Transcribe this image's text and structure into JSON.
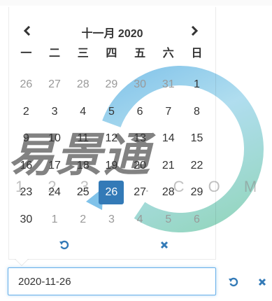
{
  "background": {
    "text_left": "...",
    "text_right": "..."
  },
  "calendar": {
    "month_title": "十一月 2020",
    "weekdays": [
      "一",
      "二",
      "三",
      "四",
      "五",
      "六",
      "日"
    ],
    "weeks": [
      [
        {
          "d": "26",
          "m": true
        },
        {
          "d": "27",
          "m": true
        },
        {
          "d": "28",
          "m": true
        },
        {
          "d": "29",
          "m": true
        },
        {
          "d": "30",
          "m": true
        },
        {
          "d": "31",
          "m": true
        },
        {
          "d": "1",
          "m": false
        }
      ],
      [
        {
          "d": "2",
          "m": false
        },
        {
          "d": "3",
          "m": false
        },
        {
          "d": "4",
          "m": false
        },
        {
          "d": "5",
          "m": false
        },
        {
          "d": "6",
          "m": false
        },
        {
          "d": "7",
          "m": false
        },
        {
          "d": "8",
          "m": false
        }
      ],
      [
        {
          "d": "9",
          "m": false
        },
        {
          "d": "10",
          "m": false
        },
        {
          "d": "11",
          "m": false
        },
        {
          "d": "12",
          "m": false
        },
        {
          "d": "13",
          "m": false
        },
        {
          "d": "14",
          "m": false
        },
        {
          "d": "15",
          "m": false
        }
      ],
      [
        {
          "d": "16",
          "m": false
        },
        {
          "d": "17",
          "m": false
        },
        {
          "d": "18",
          "m": false
        },
        {
          "d": "19",
          "m": false
        },
        {
          "d": "20",
          "m": false
        },
        {
          "d": "21",
          "m": false
        },
        {
          "d": "22",
          "m": false
        }
      ],
      [
        {
          "d": "23",
          "m": false
        },
        {
          "d": "24",
          "m": false
        },
        {
          "d": "25",
          "m": false
        },
        {
          "d": "26",
          "m": false,
          "selected": true
        },
        {
          "d": "27",
          "m": false
        },
        {
          "d": "28",
          "m": false
        },
        {
          "d": "29",
          "m": false
        }
      ],
      [
        {
          "d": "30",
          "m": false
        },
        {
          "d": "1",
          "m": true
        },
        {
          "d": "2",
          "m": true
        },
        {
          "d": "3",
          "m": true
        },
        {
          "d": "4",
          "m": true
        },
        {
          "d": "5",
          "m": true
        },
        {
          "d": "6",
          "m": true
        }
      ]
    ],
    "icons": {
      "prev": "chevron-left-icon",
      "next": "chevron-right-icon",
      "reset": "undo-icon",
      "clear": "close-icon"
    },
    "selected_color": "#337ab7"
  },
  "input": {
    "value": "2020-11-26"
  },
  "watermark": {
    "text": "易景通",
    "url": "1 2 3 0 . C O M"
  }
}
